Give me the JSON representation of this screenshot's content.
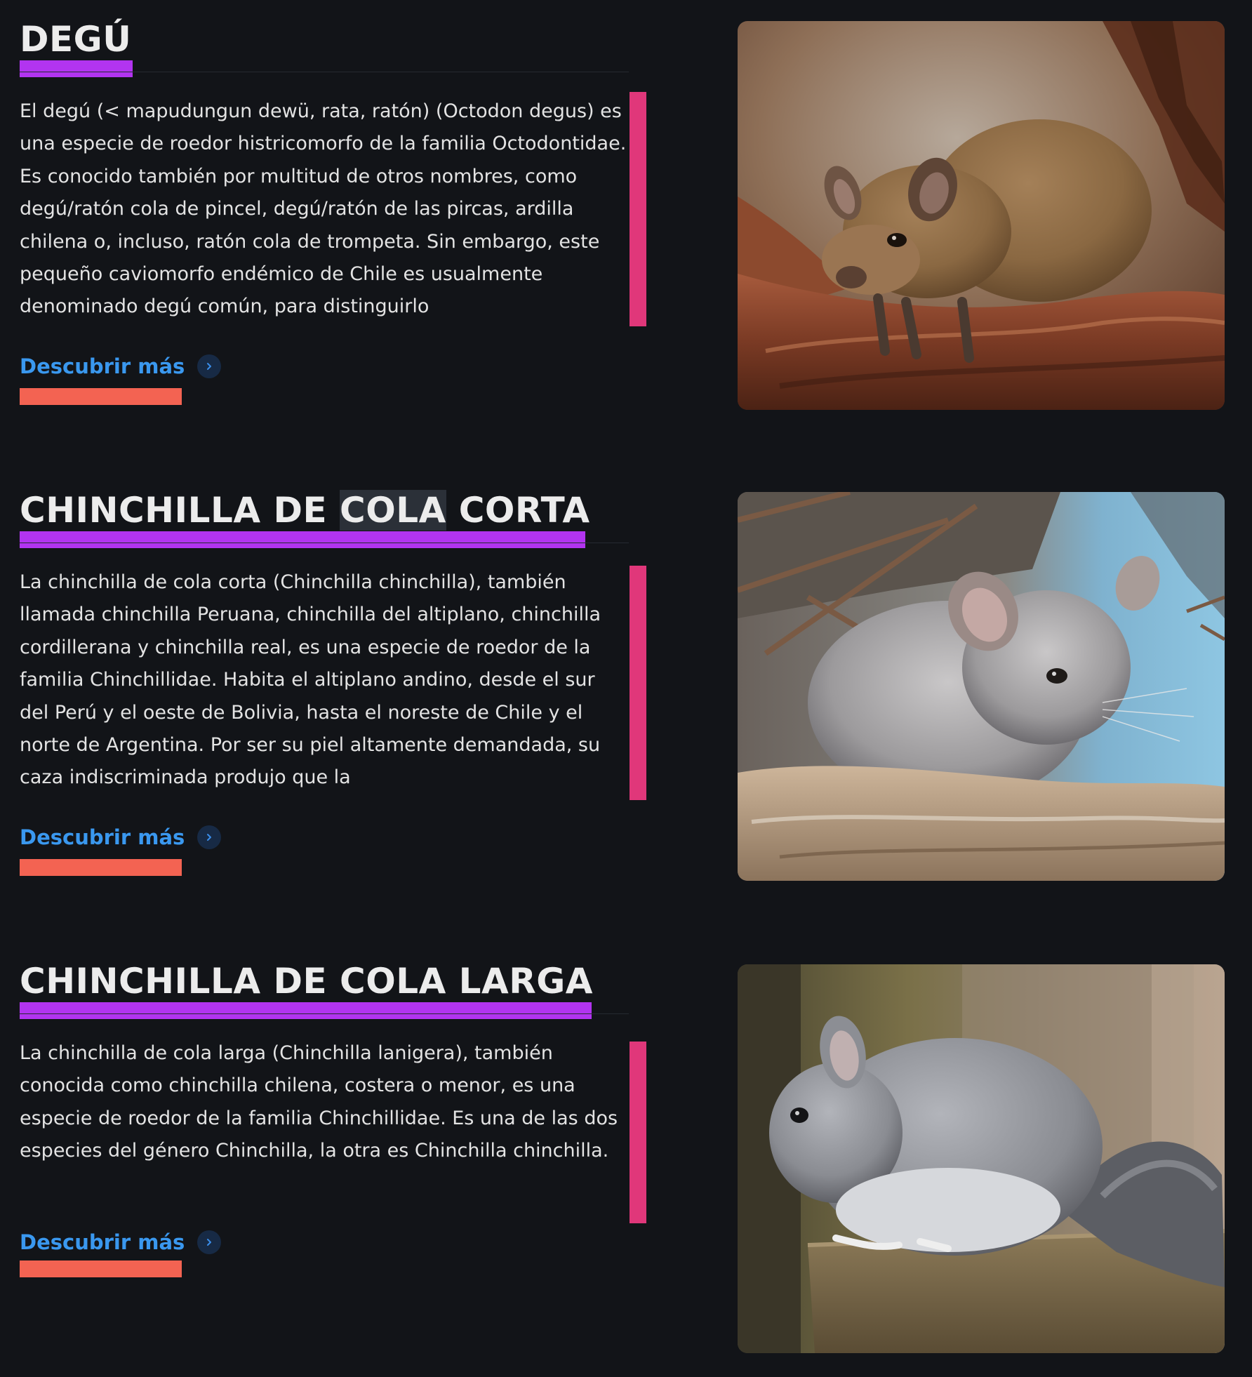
{
  "sections": [
    {
      "title": "DEGÚ",
      "description": "El degú (< mapudungun dewü, rata, ratón) (Octodon degus) es una especie de roedor histricomorfo de la familia Octodontidae. Es conocido también por multitud de otros nombres, como degú/ratón cola de pincel, degú/ratón de las pircas, ardilla chilena o, incluso, ratón cola de trompeta. Sin embargo, este pequeño caviomorfo endémico de Chile es usualmente denominado degú común, para distinguirlo",
      "link_label": "Descubrir más",
      "link_icon": "chevron-right-icon",
      "image_subject": "degu-photo"
    },
    {
      "title": "CHINCHILLA DE COLA CORTA",
      "title_parts": [
        "CHINCHILLA DE ",
        "COLA",
        " CORTA"
      ],
      "description": "La chinchilla de cola corta (Chinchilla chinchilla), también llamada chinchilla Peruana, chinchilla del altiplano, chinchilla cordillerana y chinchilla real, es una especie de roedor de la familia Chinchillidae. Habita el altiplano andino, desde el sur del Perú y el oeste de Bolivia, hasta el noreste de Chile y el norte de Argentina. Por ser su piel altamente demandada, su caza indiscriminada produjo que la",
      "link_label": "Descubrir más",
      "link_icon": "chevron-right-icon",
      "image_subject": "short-tailed-chinchilla-photo"
    },
    {
      "title": "CHINCHILLA DE COLA LARGA",
      "description": "La chinchilla de cola larga (Chinchilla lanigera), también conocida como chinchilla chilena, costera o menor, es una especie de roedor de la familia Chinchillidae. Es una de las dos especies del género Chinchilla, la otra es Chinchilla chinchilla.",
      "link_label": "Descubrir más",
      "link_icon": "chevron-right-icon",
      "image_subject": "long-tailed-chinchilla-photo"
    }
  ],
  "colors": {
    "background": "#121418",
    "title_underline": "#b234f0",
    "accent_bar": "#e0377a",
    "link": "#3a98ef",
    "link_underline": "#f36352"
  }
}
